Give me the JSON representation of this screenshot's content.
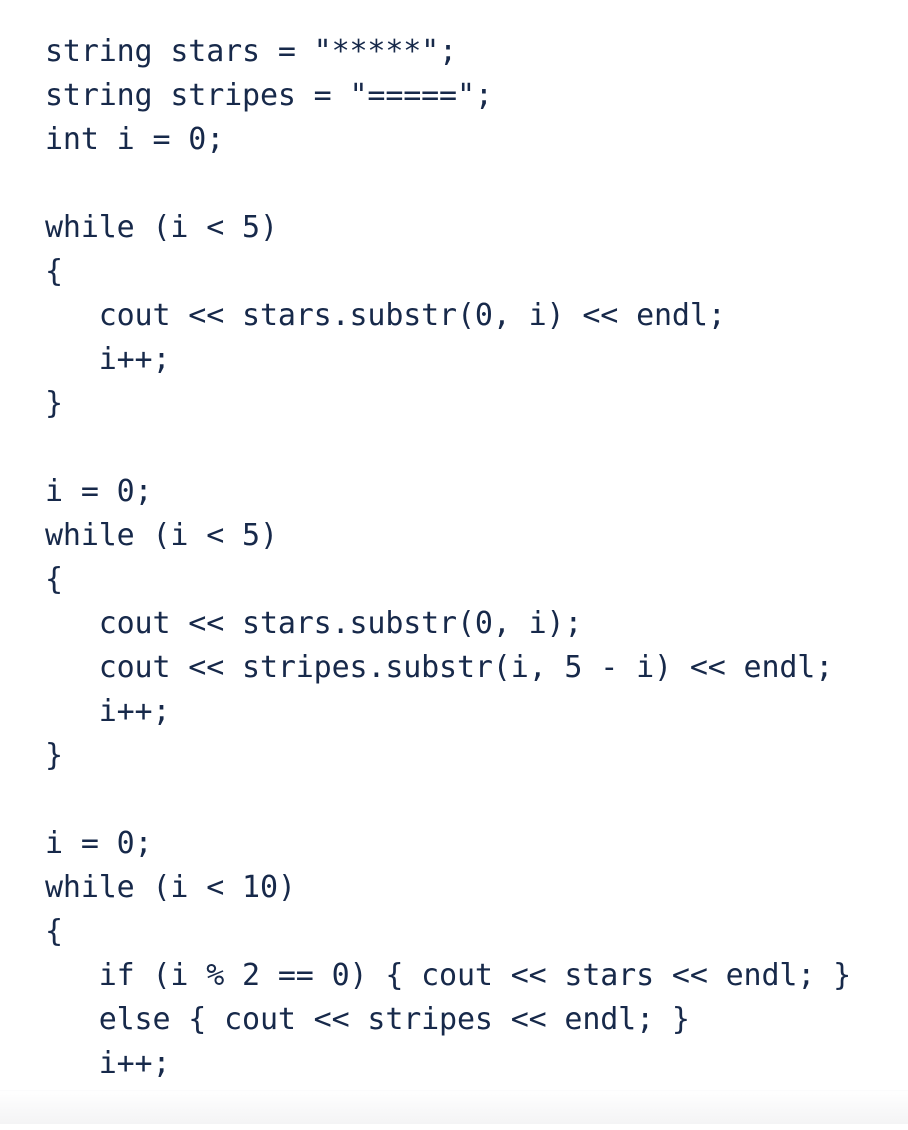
{
  "document": {
    "background_color": "#ffffff",
    "text_color": "#17294a",
    "language": "C++",
    "kind": "code-snippet"
  },
  "code": {
    "lines": [
      "string stars = \"*****\";",
      "string stripes = \"=====\";",
      "int i = 0;",
      "",
      "while (i < 5)",
      "{",
      "   cout << stars.substr(0, i) << endl;",
      "   i++;",
      "}",
      "",
      "i = 0;",
      "while (i < 5)",
      "{",
      "   cout << stars.substr(0, i);",
      "   cout << stripes.substr(i, 5 - i) << endl;",
      "   i++;",
      "}",
      "",
      "i = 0;",
      "while (i < 10)",
      "{",
      "   if (i % 2 == 0) { cout << stars << endl; }",
      "   else { cout << stripes << endl; }",
      "   i++;",
      "}"
    ]
  },
  "bottom_bar": {
    "color_top": "#ffffff",
    "color_bottom": "#f4f4f5"
  }
}
